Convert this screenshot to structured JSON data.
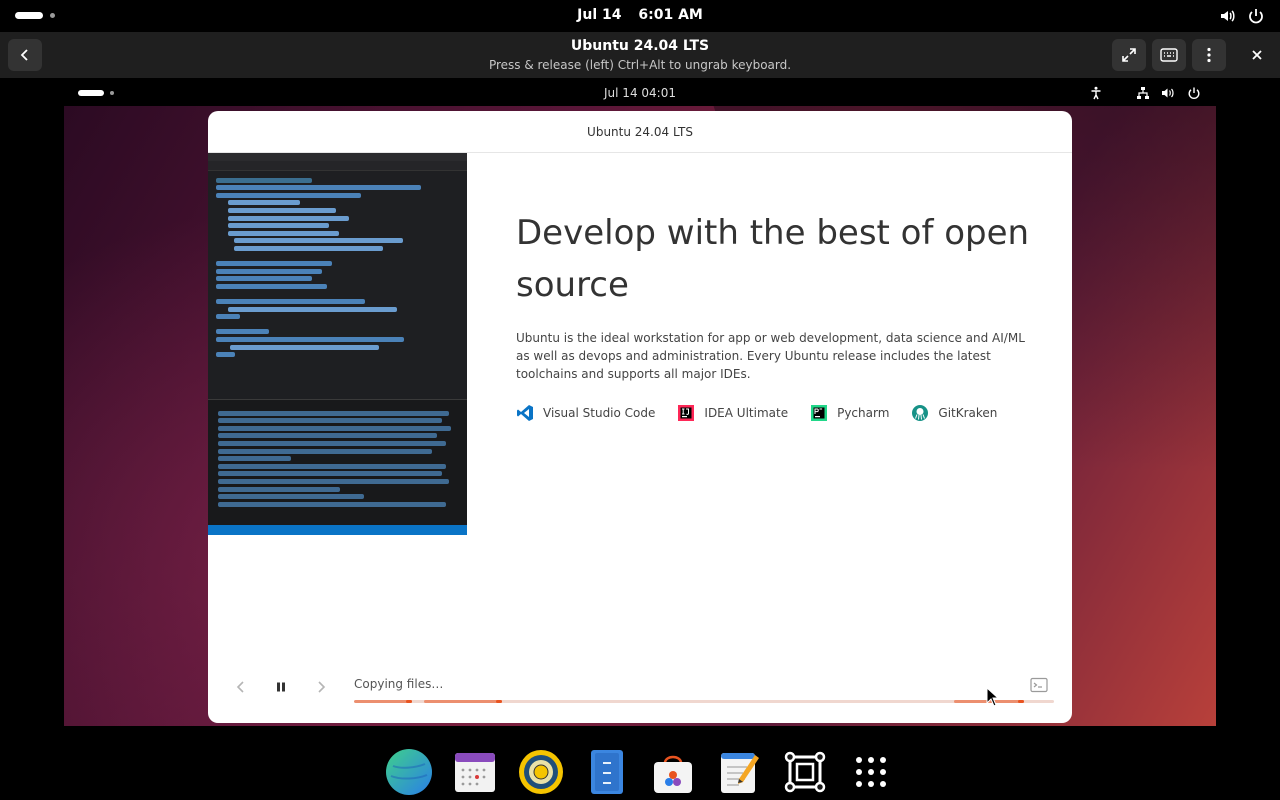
{
  "host_topbar": {
    "date": "Jul 14",
    "time": "6:01 AM",
    "tray_icons": [
      "volume-icon",
      "power-icon"
    ]
  },
  "boxes_header": {
    "title": "Ubuntu 24.04 LTS",
    "subtitle": "Press & release (left) Ctrl+Alt to ungrab keyboard.",
    "buttons": [
      "back-icon",
      "fullscreen-icon",
      "keyboard-icon",
      "menu-icon",
      "close-icon"
    ]
  },
  "vm_topbar": {
    "clock": "Jul 14  04:01",
    "tray_icons": [
      "accessibility-icon",
      "network-icon",
      "volume-icon",
      "power-icon"
    ]
  },
  "installer": {
    "window_title": "Ubuntu 24.04 LTS",
    "heading": "Develop with the best of open source",
    "description": "Ubuntu is the ideal workstation for app or web development, data science and AI/ML as well as devops and administration. Every Ubuntu release includes the latest toolchains and supports all major IDEs.",
    "ides": [
      {
        "label": "Visual Studio Code",
        "icon": "vscode-icon"
      },
      {
        "label": "IDEA Ultimate",
        "icon": "intellij-icon"
      },
      {
        "label": "Pycharm",
        "icon": "pycharm-icon"
      },
      {
        "label": "GitKraken",
        "icon": "gitkraken-icon"
      }
    ],
    "status": "Copying files…",
    "controls": [
      "previous-slide-icon",
      "pause-icon",
      "next-slide-icon",
      "terminal-icon"
    ]
  },
  "dock": {
    "apps": [
      "browser-icon",
      "calendar-icon",
      "rhythmbox-icon",
      "files-icon",
      "app-center-icon",
      "text-editor-icon",
      "boxes-icon",
      "app-grid-icon"
    ]
  },
  "colors": {
    "accent": "#e95420",
    "vscode": "#0a74c6",
    "header_bg": "#1f1f1f"
  }
}
